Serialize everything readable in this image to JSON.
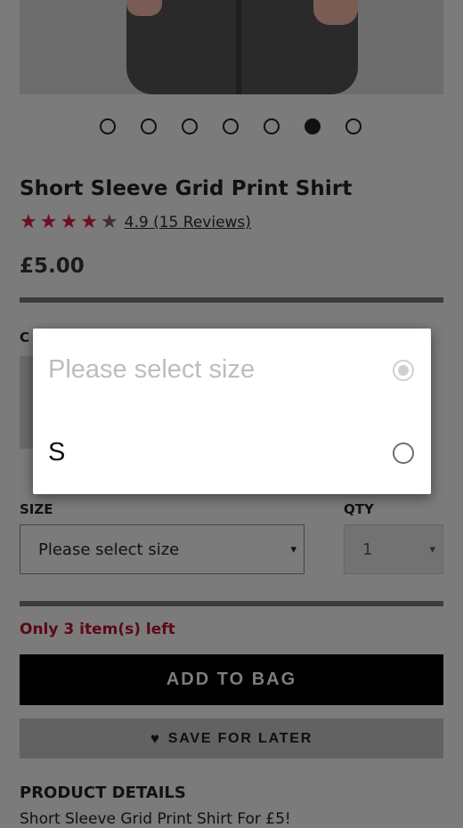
{
  "product": {
    "title": "Short Sleeve Grid Print Shirt",
    "rating_value": 4.9,
    "rating_text": "4.9 (15 Reviews)",
    "price": "£5.00",
    "colour_label": "C",
    "carousel": {
      "count": 7,
      "active_index": 5
    }
  },
  "form": {
    "size_label": "SIZE",
    "size_value": "Please select size",
    "qty_label": "QTY",
    "qty_value": "1",
    "caret": "▾"
  },
  "stock_message": "Only 3 item(s) left",
  "buttons": {
    "add_to_bag": "ADD TO BAG",
    "save_for_later": "SAVE FOR LATER"
  },
  "details": {
    "heading": "PRODUCT DETAILS",
    "text": "Short Sleeve Grid Print Shirt For £5!"
  },
  "size_dialog": {
    "options": [
      {
        "label": "Please select size",
        "selected": true
      },
      {
        "label": "S",
        "selected": false
      }
    ]
  },
  "colors": {
    "star": "#c8102e",
    "stock_text": "#a50e2d",
    "overlay": "rgba(0,0,0,0.52)"
  },
  "icons": {
    "star": "star-icon",
    "heart": "heart-icon",
    "caret": "chevron-down-icon"
  }
}
